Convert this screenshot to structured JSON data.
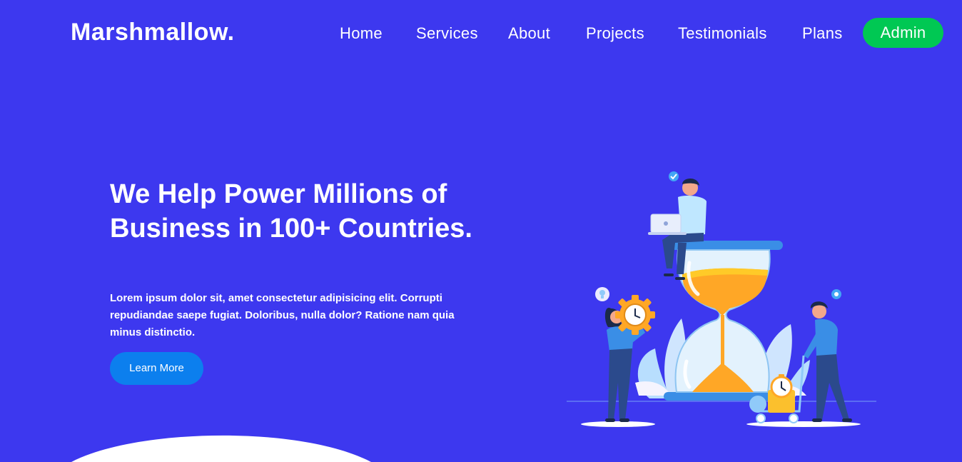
{
  "brand": {
    "logo": "Marshmallow."
  },
  "nav": {
    "items": [
      "Home",
      "Services",
      "About",
      "Projects",
      "Testimonials",
      "Plans"
    ],
    "admin_label": "Admin"
  },
  "hero": {
    "title": "We Help Power Millions of Business in 100+ Countries.",
    "description": "Lorem ipsum dolor sit, amet consectetur adipisicing elit. Corrupti repudiandae saepe fugiat. Doloribus, nulla dolor? Ratione nam quia minus distinctio.",
    "button_label": "Learn More"
  },
  "colors": {
    "background": "#3d38ef",
    "admin_button": "#00c853",
    "primary_button": "#0c7fee",
    "hourglass_sand": "#ffa726"
  },
  "icons": [
    "check-badge-icon",
    "lightbulb-icon",
    "gear-icon",
    "clock-icon",
    "stopwatch-icon"
  ]
}
